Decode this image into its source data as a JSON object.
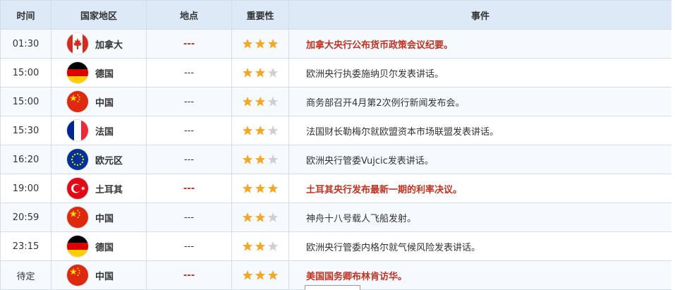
{
  "headers": {
    "time": "时间",
    "country": "国家地区",
    "location": "地点",
    "importance": "重要性",
    "event": "事件"
  },
  "colors": {
    "highlight": "#c0311f",
    "star_on": "#f5a623",
    "star_off": "#cfcfcf",
    "header_bg": "#dde9f7"
  },
  "rows": [
    {
      "time": "01:30",
      "country": "加拿大",
      "flag": "canada-flag",
      "location": "---",
      "stars": 3,
      "event": "加拿大央行公布货币政策会议纪要。",
      "important": true
    },
    {
      "time": "15:00",
      "country": "德国",
      "flag": "germany-flag",
      "location": "---",
      "stars": 2,
      "event": "欧洲央行执委施纳贝尔发表讲话。",
      "important": false
    },
    {
      "time": "15:00",
      "country": "中国",
      "flag": "china-flag",
      "location": "---",
      "stars": 2,
      "event": "商务部召开4月第2次例行新闻发布会。",
      "important": false
    },
    {
      "time": "15:30",
      "country": "法国",
      "flag": "france-flag",
      "location": "---",
      "stars": 2,
      "event": "法国财长勒梅尔就欧盟资本市场联盟发表讲话。",
      "important": false
    },
    {
      "time": "16:20",
      "country": "欧元区",
      "flag": "eu-flag",
      "location": "---",
      "stars": 2,
      "event": "欧洲央行管委Vujcic发表讲话。",
      "important": false
    },
    {
      "time": "19:00",
      "country": "土耳其",
      "flag": "turkey-flag",
      "location": "---",
      "stars": 3,
      "event": "土耳其央行发布最新一期的利率决议。",
      "important": true
    },
    {
      "time": "20:59",
      "country": "中国",
      "flag": "china-flag",
      "location": "---",
      "stars": 2,
      "event": "神舟十八号载人飞船发射。",
      "important": false
    },
    {
      "time": "23:15",
      "country": "德国",
      "flag": "germany-flag",
      "location": "---",
      "stars": 2,
      "event": "欧洲央行管委内格尔就气候风险发表讲话。",
      "important": false
    },
    {
      "time": "待定",
      "country": "中国",
      "flag": "china-flag",
      "location": "---",
      "stars": 3,
      "event": "美国国务卿布林肯访华。",
      "important": true
    }
  ]
}
